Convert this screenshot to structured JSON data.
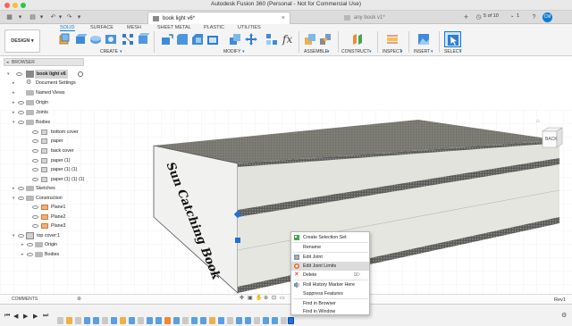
{
  "window": {
    "title": "Autodesk Fusion 360 (Personal - Not for Commercial Use)",
    "traffic_colors": [
      "#ff5f57",
      "#febc2e",
      "#28c840"
    ]
  },
  "tabs": {
    "active_tab": "book light v6*",
    "inactive_tab": "any book v1*",
    "counter": "5 of 10",
    "notifications": "1"
  },
  "ribbon": {
    "workspace": "DESIGN",
    "tabs": [
      "SOLID",
      "SURFACE",
      "MESH",
      "SHEET METAL",
      "PLASTIC",
      "UTILITIES"
    ],
    "active_tab": "SOLID",
    "groups": [
      "CREATE",
      "MODIFY",
      "ASSEMBLE",
      "CONSTRUCT",
      "INSPECT",
      "INSERT",
      "SELECT"
    ]
  },
  "browser": {
    "header": "BROWSER",
    "rows": [
      {
        "label": "book light v6",
        "icon": "document-icon"
      },
      {
        "label": "Document Settings",
        "icon": "gear-icon"
      },
      {
        "label": "Named Views",
        "icon": "folder-icon"
      },
      {
        "label": "Origin",
        "icon": "folder-icon"
      },
      {
        "label": "Joints",
        "icon": "folder-icon"
      },
      {
        "label": "Bodies",
        "icon": "folder-icon"
      },
      {
        "label": "bottom cover",
        "icon": "body-icon"
      },
      {
        "label": "paper",
        "icon": "body-icon"
      },
      {
        "label": "back cover",
        "icon": "body-icon"
      },
      {
        "label": "paper (1)",
        "icon": "body-icon"
      },
      {
        "label": "paper (1) (1)",
        "icon": "body-icon"
      },
      {
        "label": "paper (1) (1) (1)",
        "icon": "body-icon"
      },
      {
        "label": "Sketches",
        "icon": "folder-icon"
      },
      {
        "label": "Construction",
        "icon": "folder-icon"
      },
      {
        "label": "Plane1",
        "icon": "plane-icon"
      },
      {
        "label": "Plane2",
        "icon": "plane-icon"
      },
      {
        "label": "Plane3",
        "icon": "plane-icon"
      },
      {
        "label": "top cover:1",
        "icon": "component-icon"
      },
      {
        "label": "Origin",
        "icon": "folder-icon"
      },
      {
        "label": "Bodies",
        "icon": "folder-icon"
      }
    ]
  },
  "viewport": {
    "book_spine_text": "Sun Catching Book",
    "viewcube_label": "BACK"
  },
  "context_menu": {
    "items": [
      {
        "label": "Create Selection Set",
        "icon": "selection-set-icon",
        "shortcut": ""
      },
      {
        "label": "Rename",
        "icon": "",
        "shortcut": ""
      },
      {
        "label": "Edit Joint",
        "icon": "joint-icon",
        "shortcut": ""
      },
      {
        "label": "Edit Joint Limits",
        "icon": "joint-limits-icon",
        "shortcut": ""
      },
      {
        "label": "Delete",
        "icon": "delete-icon",
        "shortcut": "⌦"
      },
      {
        "label": "Roll History Marker Here",
        "icon": "history-icon",
        "shortcut": ""
      },
      {
        "label": "Suppress Features",
        "icon": "",
        "shortcut": ""
      },
      {
        "label": "Find in Browser",
        "icon": "",
        "shortcut": ""
      },
      {
        "label": "Find in Window",
        "icon": "",
        "shortcut": ""
      }
    ],
    "highlighted": "Edit Joint Limits"
  },
  "bottom": {
    "comments_label": "COMMENTS",
    "revision": "Rev1"
  },
  "colors": {
    "accent": "#0a7bd1",
    "book_top": "#7f7f77",
    "book_side": "#e3e3dd",
    "paper_edge": "#5b5b59"
  }
}
